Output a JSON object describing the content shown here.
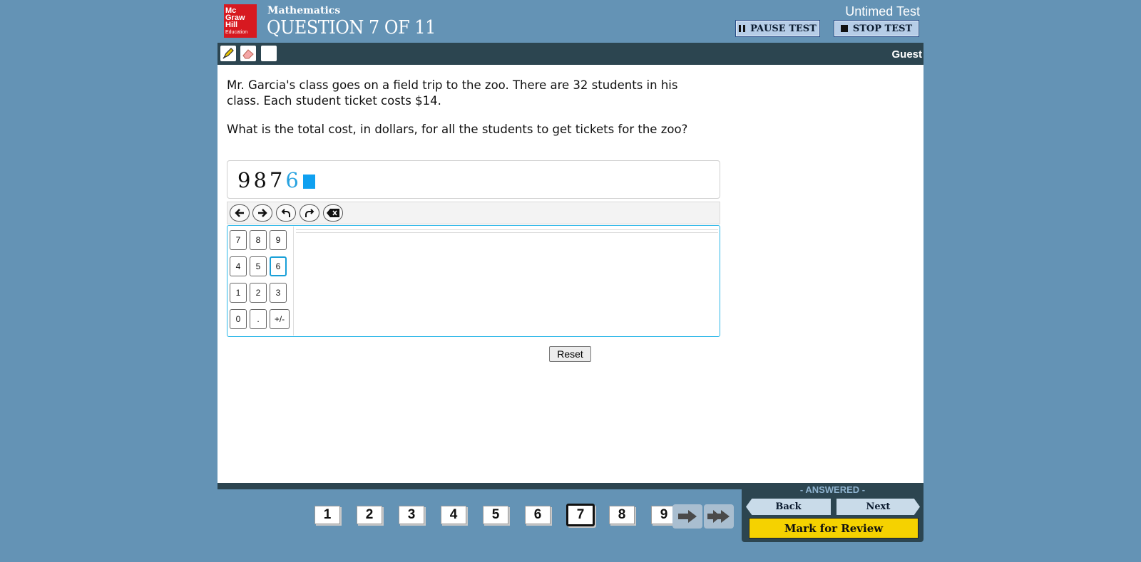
{
  "header": {
    "logo_lines": [
      "Mc",
      "Graw",
      "Hill",
      "Education"
    ],
    "subject": "Mathematics",
    "question_title": "QUESTION 7 OF 11",
    "timer_mode": "Untimed Test",
    "pause_label": "PAUSE TEST",
    "stop_label": "STOP TEST"
  },
  "toolbar": {
    "tools": [
      "highlighter-icon",
      "eraser-icon",
      "blank-tool"
    ],
    "user": "Guest"
  },
  "question": {
    "paragraph1": "Mr. Garcia's class goes on a field trip to the zoo. There are 32 students in his class. Each student ticket costs $14.",
    "paragraph2": "What is the total cost, in dollars, for all the students to get tickets for the zoo?"
  },
  "answer": {
    "entered_digits": "987",
    "last_digit": "6"
  },
  "editor_controls": [
    "arrow-left-icon",
    "arrow-right-icon",
    "undo-icon",
    "redo-icon",
    "backspace-icon"
  ],
  "keypad": {
    "rows": [
      [
        "7",
        "8",
        "9"
      ],
      [
        "4",
        "5",
        "6"
      ],
      [
        "1",
        "2",
        "3"
      ],
      [
        "0",
        ".",
        "+/-"
      ]
    ],
    "selected_key": "6"
  },
  "reset_label": "Reset",
  "navigation": {
    "status": "- ANSWERED -",
    "back_label": "Back",
    "next_label": "Next",
    "mark_label": "Mark for Review",
    "question_numbers": [
      "1",
      "2",
      "3",
      "4",
      "5",
      "6",
      "7",
      "8",
      "9"
    ],
    "current_question": "7",
    "colors": {
      "accent_yellow": "#f5d200",
      "background": "#6493b5",
      "dark_bar": "#2c4550"
    }
  }
}
